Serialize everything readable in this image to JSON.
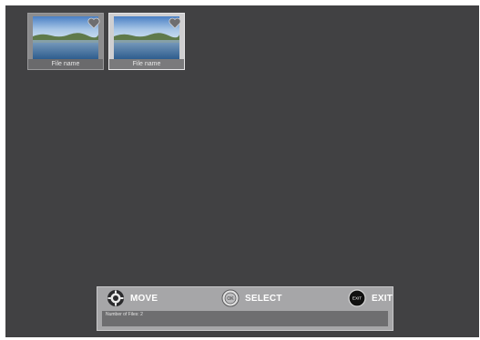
{
  "files": [
    {
      "name": "File name",
      "favorite": true,
      "selected": false
    },
    {
      "name": "File name",
      "favorite": true,
      "selected": true
    }
  ],
  "controls": {
    "move_label": "MOVE",
    "select_label": "SELECT",
    "exit_label": "EXIT",
    "ok_icon_text": "OK",
    "exit_icon_text": "EXIT"
  },
  "status": {
    "file_count_text": "Number of Files: 2"
  },
  "icons": {
    "move": "dpad-icon",
    "select": "ok-button-icon",
    "exit": "exit-button-icon",
    "favorite": "heart-icon"
  },
  "colors": {
    "background": "#414143",
    "tile": "#8c8c8e",
    "tile_selected": "#cfcfd1",
    "bar": "#a6a6a8"
  }
}
